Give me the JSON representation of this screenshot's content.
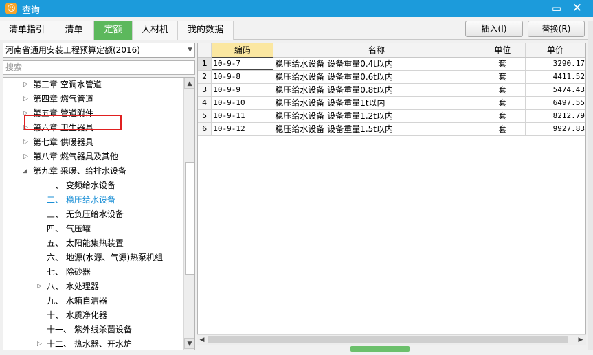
{
  "window": {
    "title": "查询",
    "maximize_icon": "maximize-icon",
    "close_icon": "close-icon"
  },
  "tabs": [
    "清单指引",
    "清单",
    "定额",
    "人材机",
    "我的数据"
  ],
  "active_tab": "定额",
  "toolbar": {
    "insert_label": "插入(I)",
    "replace_label": "替换(R)"
  },
  "quota_library": {
    "selected": "河南省通用安装工程预算定额(2016)"
  },
  "search": {
    "placeholder": "搜索"
  },
  "tree": {
    "items": [
      {
        "label": "第三章 空调水管道",
        "expander": "▷"
      },
      {
        "label": "第四章 燃气管道",
        "expander": "▷"
      },
      {
        "label": "第五章 管道附件",
        "expander": "▷"
      },
      {
        "label": "第六章 卫生器具",
        "expander": "▷"
      },
      {
        "label": "第七章 供暖器具",
        "expander": "▷"
      },
      {
        "label": "第八章 燃气器具及其他",
        "expander": "▷"
      },
      {
        "label": "第九章 采暖、给排水设备",
        "expander": "◢"
      },
      {
        "label": "一、 变频给水设备",
        "expander": ""
      },
      {
        "label": "二、 稳压给水设备",
        "expander": ""
      },
      {
        "label": "三、 无负压给水设备",
        "expander": ""
      },
      {
        "label": "四、 气压罐",
        "expander": ""
      },
      {
        "label": "五、 太阳能集热装置",
        "expander": ""
      },
      {
        "label": "六、 地源(水源、气源)热泵机组",
        "expander": ""
      },
      {
        "label": "七、 除砂器",
        "expander": ""
      },
      {
        "label": "八、 水处理器",
        "expander": "▷"
      },
      {
        "label": "九、 水箱自洁器",
        "expander": ""
      },
      {
        "label": "十、 水质净化器",
        "expander": ""
      },
      {
        "label": "十一、 紫外线杀菌设备",
        "expander": ""
      },
      {
        "label": "十二、 热水器、开水炉",
        "expander": "▷"
      }
    ],
    "selected_label": "二、 稳压给水设备"
  },
  "grid": {
    "headers": {
      "code": "编码",
      "name": "名称",
      "unit": "单位",
      "price": "单价"
    },
    "rows": [
      {
        "no": "1",
        "code": "10-9-7",
        "name": "稳压给水设备 设备重量0.4t以内",
        "unit": "套",
        "price": "3290.17"
      },
      {
        "no": "2",
        "code": "10-9-8",
        "name": "稳压给水设备 设备重量0.6t以内",
        "unit": "套",
        "price": "4411.52"
      },
      {
        "no": "3",
        "code": "10-9-9",
        "name": "稳压给水设备 设备重量0.8t以内",
        "unit": "套",
        "price": "5474.43"
      },
      {
        "no": "4",
        "code": "10-9-10",
        "name": "稳压给水设备 设备重量1t以内",
        "unit": "套",
        "price": "6497.55"
      },
      {
        "no": "5",
        "code": "10-9-11",
        "name": "稳压给水设备 设备重量1.2t以内",
        "unit": "套",
        "price": "8212.79"
      },
      {
        "no": "6",
        "code": "10-9-12",
        "name": "稳压给水设备 设备重量1.5t以内",
        "unit": "套",
        "price": "9927.83"
      }
    ]
  },
  "colors": {
    "titlebar": "#1c9bdb",
    "active_tab": "#5cb85c",
    "selected_tree_text": "#1a8fd6",
    "highlight_box": "#e02020",
    "code_header": "#fbe7a1"
  }
}
